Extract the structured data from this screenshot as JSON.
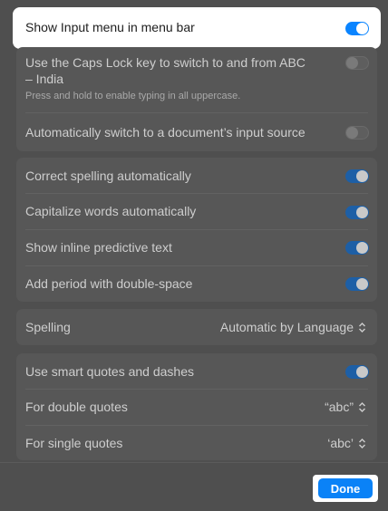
{
  "input_menu": {
    "label": "Show Input menu in menu bar",
    "on": true
  },
  "input_group": {
    "caps_lock": {
      "label_line1": "Use the Caps Lock key to switch to and from ABC",
      "label_line2": "– India",
      "hint": "Press and hold to enable typing in all uppercase.",
      "on": false
    },
    "auto_switch": {
      "label": "Automatically switch to a document’s input source",
      "on": false
    }
  },
  "text_group": {
    "items": [
      {
        "label": "Correct spelling automatically",
        "on": true
      },
      {
        "label": "Capitalize words automatically",
        "on": true
      },
      {
        "label": "Show inline predictive text",
        "on": true
      },
      {
        "label": "Add period with double-space",
        "on": true
      }
    ]
  },
  "spelling": {
    "label": "Spelling",
    "value": "Automatic by Language"
  },
  "quotes_group": {
    "smart_quotes": {
      "label": "Use smart quotes and dashes",
      "on": true
    },
    "double_quotes": {
      "label": "For double quotes",
      "value": "“abc”"
    },
    "single_quotes": {
      "label": "For single quotes",
      "value": "‘abc’"
    }
  },
  "footer": {
    "done_label": "Done"
  },
  "colors": {
    "accent": "#0a84ff",
    "toggle_on_dimmed": "#1d5fa6",
    "panel": "#575757"
  }
}
